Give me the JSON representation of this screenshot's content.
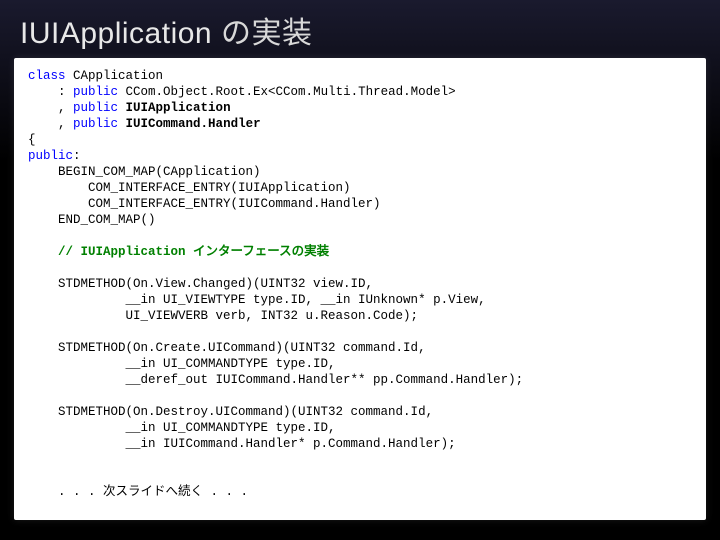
{
  "title": {
    "main": "IUIApplication",
    "sub": " の実装"
  },
  "code": {
    "l01a": "class",
    "l01b": " CApplication",
    "l02a": "    : ",
    "l02b": "public",
    "l02c": " CCom.Object.Root.Ex<CCom.Multi.Thread.Model>",
    "l03a": "    , ",
    "l03b": "public",
    "l03c": " ",
    "l03d": "IUIApplication",
    "l04a": "    , ",
    "l04b": "public",
    "l04c": " ",
    "l04d": "IUICommand.Handler",
    "l05": "{",
    "l06a": "public",
    "l06b": ":",
    "l07": "    BEGIN_COM_MAP(CApplication)",
    "l08": "        COM_INTERFACE_ENTRY(IUIApplication)",
    "l09": "        COM_INTERFACE_ENTRY(IUICommand.Handler)",
    "l10": "    END_COM_MAP()",
    "blank1": "",
    "l11": "    // IUIApplication インターフェースの実装",
    "blank2": "",
    "l12": "    STDMETHOD(On.View.Changed)(UINT32 view.ID,",
    "l13": "             __in UI_VIEWTYPE type.ID, __in IUnknown* p.View,",
    "l14": "             UI_VIEWVERB verb, INT32 u.Reason.Code);",
    "blank3": "",
    "l15": "    STDMETHOD(On.Create.UICommand)(UINT32 command.Id,",
    "l16": "             __in UI_COMMANDTYPE type.ID,",
    "l17": "             __deref_out IUICommand.Handler** pp.Command.Handler);",
    "blank4": "",
    "l18": "    STDMETHOD(On.Destroy.UICommand)(UINT32 command.Id,",
    "l19": "             __in UI_COMMANDTYPE type.ID,",
    "l20": "             __in IUICommand.Handler* p.Command.Handler);",
    "blank5": "",
    "blank6": "",
    "l21": "    . . . 次スライドへ続く . . ."
  }
}
